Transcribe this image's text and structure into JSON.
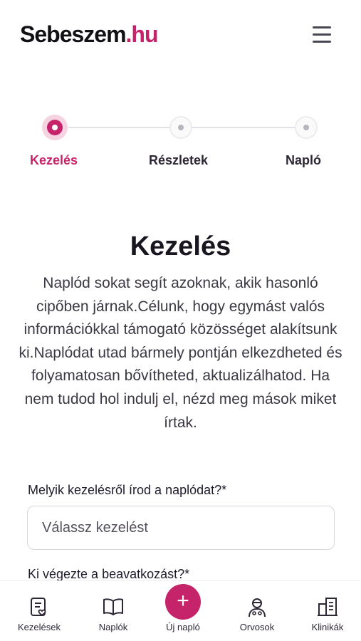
{
  "header": {
    "logo_main": "Sebeszem",
    "logo_accent": ".hu"
  },
  "colors": {
    "accent": "#c5246b",
    "text": "#1f1a2b",
    "muted": "#54505c"
  },
  "stepper": {
    "steps": [
      {
        "label": "Kezelés",
        "state": "active"
      },
      {
        "label": "Részletek",
        "state": "inactive"
      },
      {
        "label": "Napló",
        "state": "inactive"
      }
    ]
  },
  "main": {
    "title": "Kezelés",
    "intro": "Naplód sokat segít azoknak, akik hasonló cipőben járnak.Célunk, hogy egymást valós információkkal támogató közösséget alakítsunk ki.Naplódat utad bármely pontján elkezdheted és folyamatosan bővítheted, aktualizálhatod. Ha nem tudod hol indulj el, nézd meg mások miket írtak.",
    "field1_label": "Melyik kezelésről írod a naplódat?*",
    "field1_placeholder": "Válassz kezelést",
    "field2_label": "Ki végezte a beavatkozást?*"
  },
  "bottom_nav": {
    "items": [
      {
        "label": "Kezelések",
        "icon": "treatments-icon"
      },
      {
        "label": "Naplók",
        "icon": "book-icon"
      },
      {
        "label": "Új napló",
        "icon": "plus-icon"
      },
      {
        "label": "Orvosok",
        "icon": "doctor-icon"
      },
      {
        "label": "Klinikák",
        "icon": "clinic-icon"
      }
    ],
    "fab_symbol": "+"
  }
}
